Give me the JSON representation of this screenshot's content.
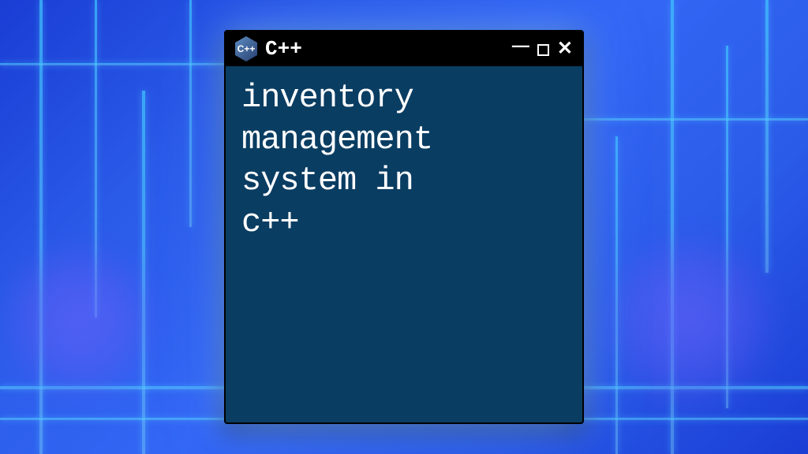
{
  "window": {
    "title": "C++",
    "logo_text": "C++",
    "content": "inventory\nmanagement\nsystem in\nc++"
  },
  "controls": {
    "minimize": "—",
    "close": "✕"
  },
  "colors": {
    "window_bg": "#0a3d62",
    "titlebar_bg": "#000000",
    "text": "#ffffff",
    "background_primary": "#2a5ae8",
    "glow": "#50c8ff"
  }
}
